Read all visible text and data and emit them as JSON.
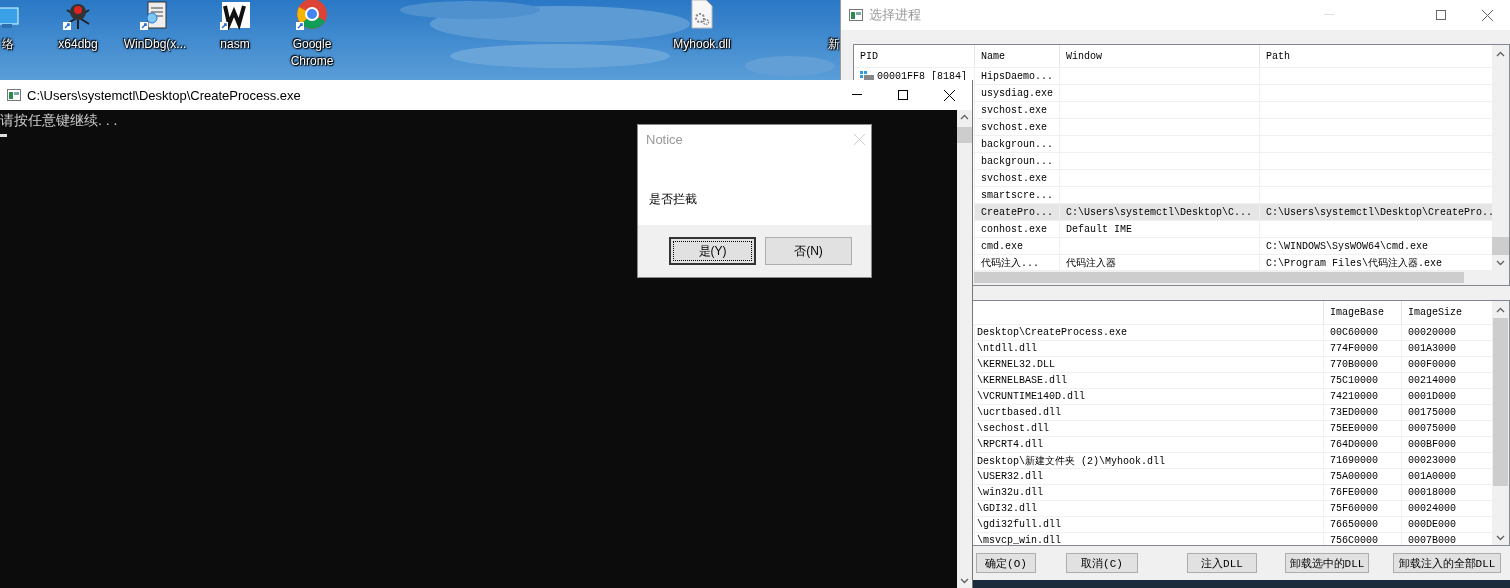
{
  "desktop": {
    "icons": [
      {
        "label": "络",
        "kind": "monitor"
      },
      {
        "label": "x64dbg",
        "kind": "bug"
      },
      {
        "label": "WinDbg(x...",
        "kind": "debugger"
      },
      {
        "label": "nasm",
        "kind": "asm"
      },
      {
        "label": "Google Chrome",
        "kind": "browser"
      },
      {
        "label": "Myhook.dll",
        "kind": "dll"
      },
      {
        "label": "新"
      }
    ]
  },
  "process_window": {
    "title": "选择进程",
    "process_list": {
      "columns": [
        "PID",
        "Name",
        "Window",
        "Path"
      ],
      "rows": [
        {
          "pid": "00001FF8 [8184]",
          "name": "HipsDaemo...",
          "selected": false
        },
        {
          "name": "usysdiag.exe",
          "selected": false
        },
        {
          "name": "svchost.exe",
          "selected": false
        },
        {
          "name": "svchost.exe",
          "selected": false
        },
        {
          "name": "backgroun...",
          "selected": false
        },
        {
          "name": "backgroun...",
          "selected": false
        },
        {
          "name": "svchost.exe",
          "selected": false
        },
        {
          "name": "smartscre...",
          "selected": false
        },
        {
          "name": "CreatePro...",
          "window": "C:\\Users\\systemctl\\Desktop\\C...",
          "path": "C:\\Users\\systemctl\\Desktop\\CreatePro..",
          "selected": true
        },
        {
          "name": "conhost.exe",
          "window": "Default IME",
          "selected": false
        },
        {
          "name": "cmd.exe",
          "path": "C:\\WINDOWS\\SysWOW64\\cmd.exe",
          "selected": false
        },
        {
          "name": "代码注入...",
          "window": "代码注入器",
          "path": "C:\\Program Files\\代码注入器.exe",
          "selected": false
        }
      ]
    },
    "module_list": {
      "columns": [
        "ImageBase",
        "ImageSize"
      ],
      "rows": [
        {
          "path": "Desktop\\CreateProcess.exe",
          "image_base": "00C60000",
          "image_size": "00020000"
        },
        {
          "path": "\\ntdll.dll",
          "image_base": "774F0000",
          "image_size": "001A3000"
        },
        {
          "path": "\\KERNEL32.DLL",
          "image_base": "770B0000",
          "image_size": "000F0000"
        },
        {
          "path": "\\KERNELBASE.dll",
          "image_base": "75C10000",
          "image_size": "00214000"
        },
        {
          "path": "\\VCRUNTIME140D.dll",
          "image_base": "74210000",
          "image_size": "0001D000"
        },
        {
          "path": "\\ucrtbased.dll",
          "image_base": "73ED0000",
          "image_size": "00175000"
        },
        {
          "path": "\\sechost.dll",
          "image_base": "75EE0000",
          "image_size": "00075000"
        },
        {
          "path": "\\RPCRT4.dll",
          "image_base": "764D0000",
          "image_size": "000BF000"
        },
        {
          "path": "Desktop\\新建文件夹 (2)\\Myhook.dll",
          "image_base": "71690000",
          "image_size": "00023000"
        },
        {
          "path": "\\USER32.dll",
          "image_base": "75A00000",
          "image_size": "001A0000"
        },
        {
          "path": "\\win32u.dll",
          "image_base": "76FE0000",
          "image_size": "00018000"
        },
        {
          "path": "\\GDI32.dll",
          "image_base": "75F60000",
          "image_size": "00024000"
        },
        {
          "path": "\\gdi32full.dll",
          "image_base": "76650000",
          "image_size": "000DE000"
        },
        {
          "path": "\\msvcp_win.dll",
          "image_base": "756C0000",
          "image_size": "0007B000"
        }
      ]
    },
    "buttons": [
      "确定(O)",
      "取消(C)",
      "注入DLL",
      "卸载选中的DLL",
      "卸载注入的全部DLL"
    ]
  },
  "console_window": {
    "title": "C:\\Users\\systemctl\\Desktop\\CreateProcess.exe",
    "lines": [
      "请按任意键继续. . ."
    ]
  },
  "dialog": {
    "title": "Notice",
    "message": "是否拦截",
    "buttons": [
      {
        "label": "是(Y)",
        "focused": true
      },
      {
        "label": "否(N)",
        "focused": false
      }
    ]
  }
}
